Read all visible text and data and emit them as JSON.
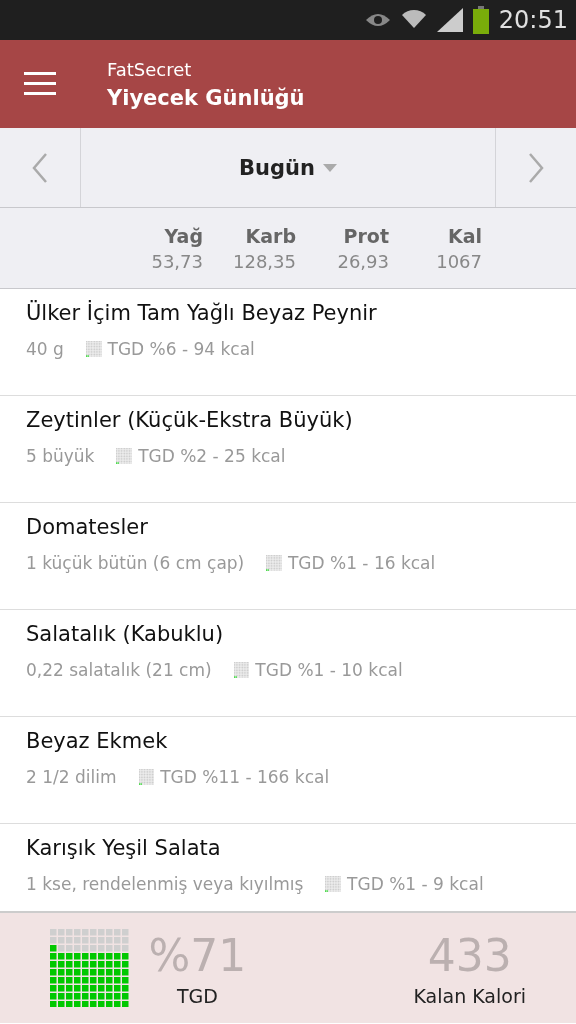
{
  "status_bar": {
    "time": "20:51"
  },
  "app_bar": {
    "app_name": "FatSecret",
    "title": "Yiyecek Günlüğü"
  },
  "date_nav": {
    "label": "Bugün"
  },
  "totals": [
    {
      "label": "Yağ",
      "value": "53,73"
    },
    {
      "label": "Karb",
      "value": "128,35"
    },
    {
      "label": "Prot",
      "value": "26,93"
    },
    {
      "label": "Kal",
      "value": "1067"
    }
  ],
  "entries": [
    {
      "name": "Ülker İçim Tam Yağlı Beyaz Peynir",
      "portion": "40  g",
      "summary": "TGD %6 - 94 kcal"
    },
    {
      "name": "Zeytinler (Küçük-Ekstra Büyük)",
      "portion": "5  büyük",
      "summary": "TGD %2 - 25 kcal"
    },
    {
      "name": "Domatesler",
      "portion": "1  küçük bütün (6 cm çap)",
      "summary": "TGD %1 - 16 kcal"
    },
    {
      "name": "Salatalık (Kabuklu)",
      "portion": "0,22 salatalık (21 cm)",
      "summary": "TGD %1 - 10 kcal"
    },
    {
      "name": "Beyaz Ekmek",
      "portion": "2 1/2 dilim",
      "summary": "TGD %11 - 166 kcal"
    },
    {
      "name": "Karışık Yeşil Salata",
      "portion": "1  kse, rendelenmiş veya kıyılmış",
      "summary": "TGD %1 - 9 kcal"
    }
  ],
  "footer": {
    "percent": "%71",
    "percent_label": "TGD",
    "remaining": "433",
    "remaining_label": "Kalan Kalori"
  }
}
